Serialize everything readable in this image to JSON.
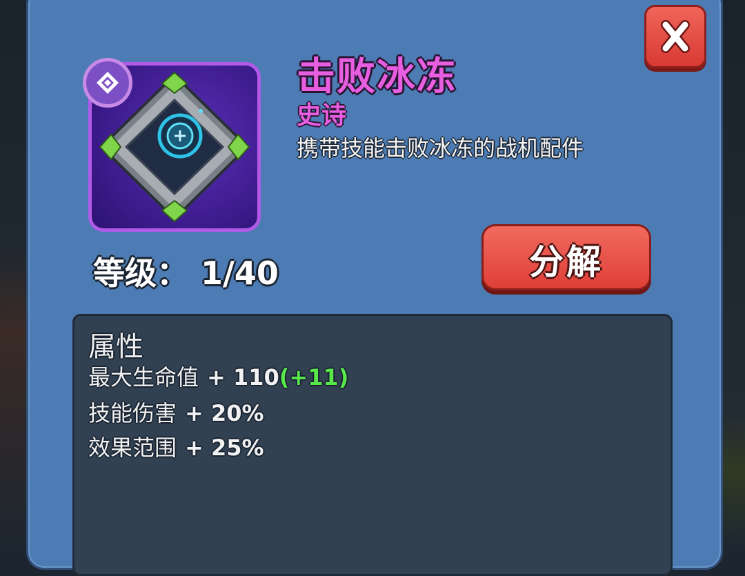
{
  "item": {
    "name": "击败冰冻",
    "rarity": "史诗",
    "description": "携带技能击败冰冻的战机配件",
    "level_label": "等级：",
    "level_value": "1/40",
    "icon": "aircraft-part-square-frame-icon",
    "rarity_icon": "diamond-icon"
  },
  "buttons": {
    "close_icon": "close-x-icon",
    "dismantle_label": "分解"
  },
  "attributes": {
    "header": "属性",
    "rows": [
      {
        "name": "最大生命值",
        "value": "+ 110",
        "bonus": "(+11)"
      },
      {
        "name": "技能伤害",
        "value": "+ 20%",
        "bonus": ""
      },
      {
        "name": "效果范围",
        "value": "+ 25%",
        "bonus": ""
      }
    ]
  },
  "colors": {
    "panel": "#4d7cb4",
    "epic": "#e85ee0",
    "button_red": "#de3f37",
    "bonus_green": "#58e84a",
    "stats_bg": "#324152"
  }
}
